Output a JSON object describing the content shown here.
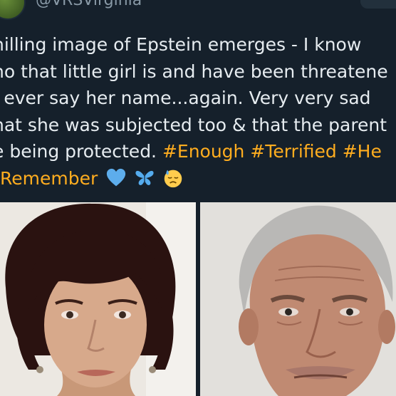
{
  "tweet": {
    "handle": "@VRSVirginia",
    "lines": [
      {
        "text": "hilling image of Epstein emerges - I know"
      },
      {
        "text": "ho that little girl is and have been threatene"
      },
      {
        "text": "I ever say her name...again. Very very sad"
      },
      {
        "text": "hat she was subjected too & that the parent"
      },
      {
        "text": "e being protected. ",
        "tags": [
          "#Enough",
          "#Terrified",
          "#He"
        ]
      },
      {
        "tags": [
          "Remember"
        ],
        "emojis": [
          "blue-heart-icon",
          "butterfly-icon",
          "sad-sweat-face-icon"
        ]
      }
    ]
  },
  "colors": {
    "background": "#15202b",
    "text": "#e6ecf0",
    "hashtag": "#ffad1f",
    "muted": "#8899a6"
  },
  "media": {
    "photos": [
      "woman-portrait-photo",
      "man-mugshot-photo"
    ]
  }
}
